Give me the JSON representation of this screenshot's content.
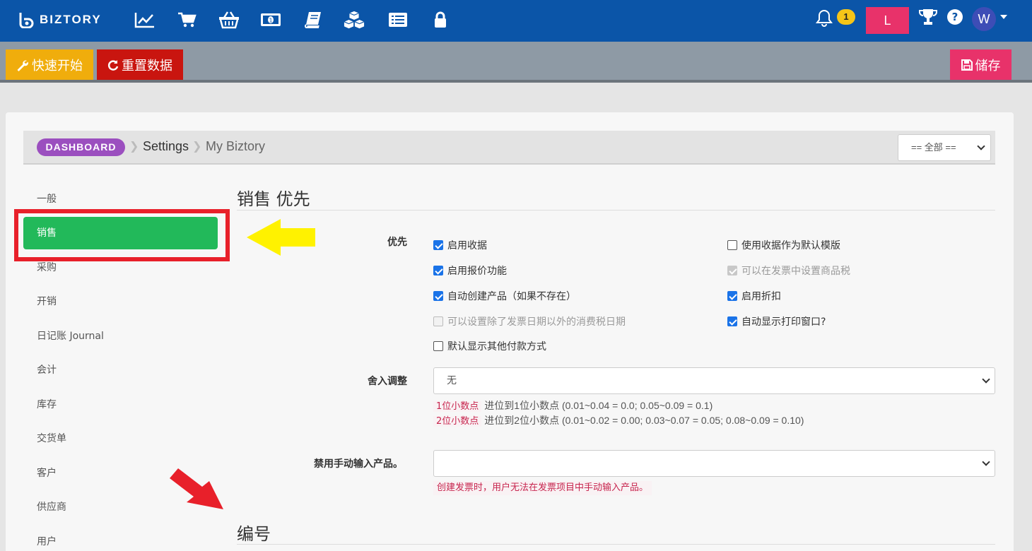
{
  "app": {
    "brand": "BIZTORY",
    "nav_icons": [
      "chart-line-icon",
      "cart-icon",
      "basket-icon",
      "money-icon",
      "book-icon",
      "cubes-icon",
      "list-icon",
      "lock-icon"
    ],
    "notifications_count": "1",
    "user_initial_l": "L",
    "avatar_initial": "W"
  },
  "actions": {
    "quick_start": "快速开始",
    "reset_data": "重置数据",
    "save": "储存"
  },
  "breadcrumb": {
    "items": [
      "DASHBOARD",
      "Settings",
      "My Biztory"
    ]
  },
  "filter": {
    "selected": "== 全部 =="
  },
  "sidebar": {
    "items": [
      "一般",
      "销售",
      "采购",
      "开销",
      "日记账 Journal",
      "会计",
      "库存",
      "交货单",
      "客户",
      "供应商",
      "用户"
    ],
    "active": "销售"
  },
  "sales_section": {
    "title": "销售 优先",
    "pref_label": "优先",
    "checkboxes_left": [
      {
        "label": "启用收据",
        "checked": true,
        "disabled": false
      },
      {
        "label": "启用报价功能",
        "checked": true,
        "disabled": false
      },
      {
        "label": "自动创建产品（如果不存在）",
        "checked": true,
        "disabled": false
      },
      {
        "label": "可以设置除了发票日期以外的消费税日期",
        "checked": false,
        "disabled": true
      },
      {
        "label": "默认显示其他付款方式",
        "checked": false,
        "disabled": false
      }
    ],
    "checkboxes_right": [
      {
        "label": "使用收据作为默认模版",
        "checked": false,
        "disabled": false
      },
      {
        "label": "可以在发票中设置商品税",
        "checked": true,
        "disabled": true
      },
      {
        "label": "启用折扣",
        "checked": true,
        "disabled": false
      },
      {
        "label": "自动显示打印窗口?",
        "checked": true,
        "disabled": false
      }
    ],
    "rounding_label": "舍入调整",
    "rounding_value": "无",
    "rounding_hints": [
      {
        "tag": "1位小数点",
        "text": "进位到1位小数点 (0.01~0.04 = 0.0; 0.05~0.09 = 0.1)"
      },
      {
        "tag": "2位小数点",
        "text": "进位到2位小数点 (0.01~0.02 = 0.00; 0.03~0.07 = 0.05; 0.08~0.09 = 0.10)"
      }
    ],
    "disable_manual_label": "禁用手动输入产品。",
    "disable_manual_value": "",
    "disable_manual_hint": "创建发票时，用户无法在发票项目中手动输入产品。"
  },
  "numbering_section": {
    "title": "编号"
  },
  "colors": {
    "navbar": "#0b55a8",
    "quick_start": "#f0ad0c",
    "reset": "#c9150f",
    "save": "#e8326a",
    "active_menu": "#22b95a",
    "highlight_box": "#e8202a",
    "yellow_arrow": "#fff200",
    "red_arrow": "#e8202a"
  }
}
